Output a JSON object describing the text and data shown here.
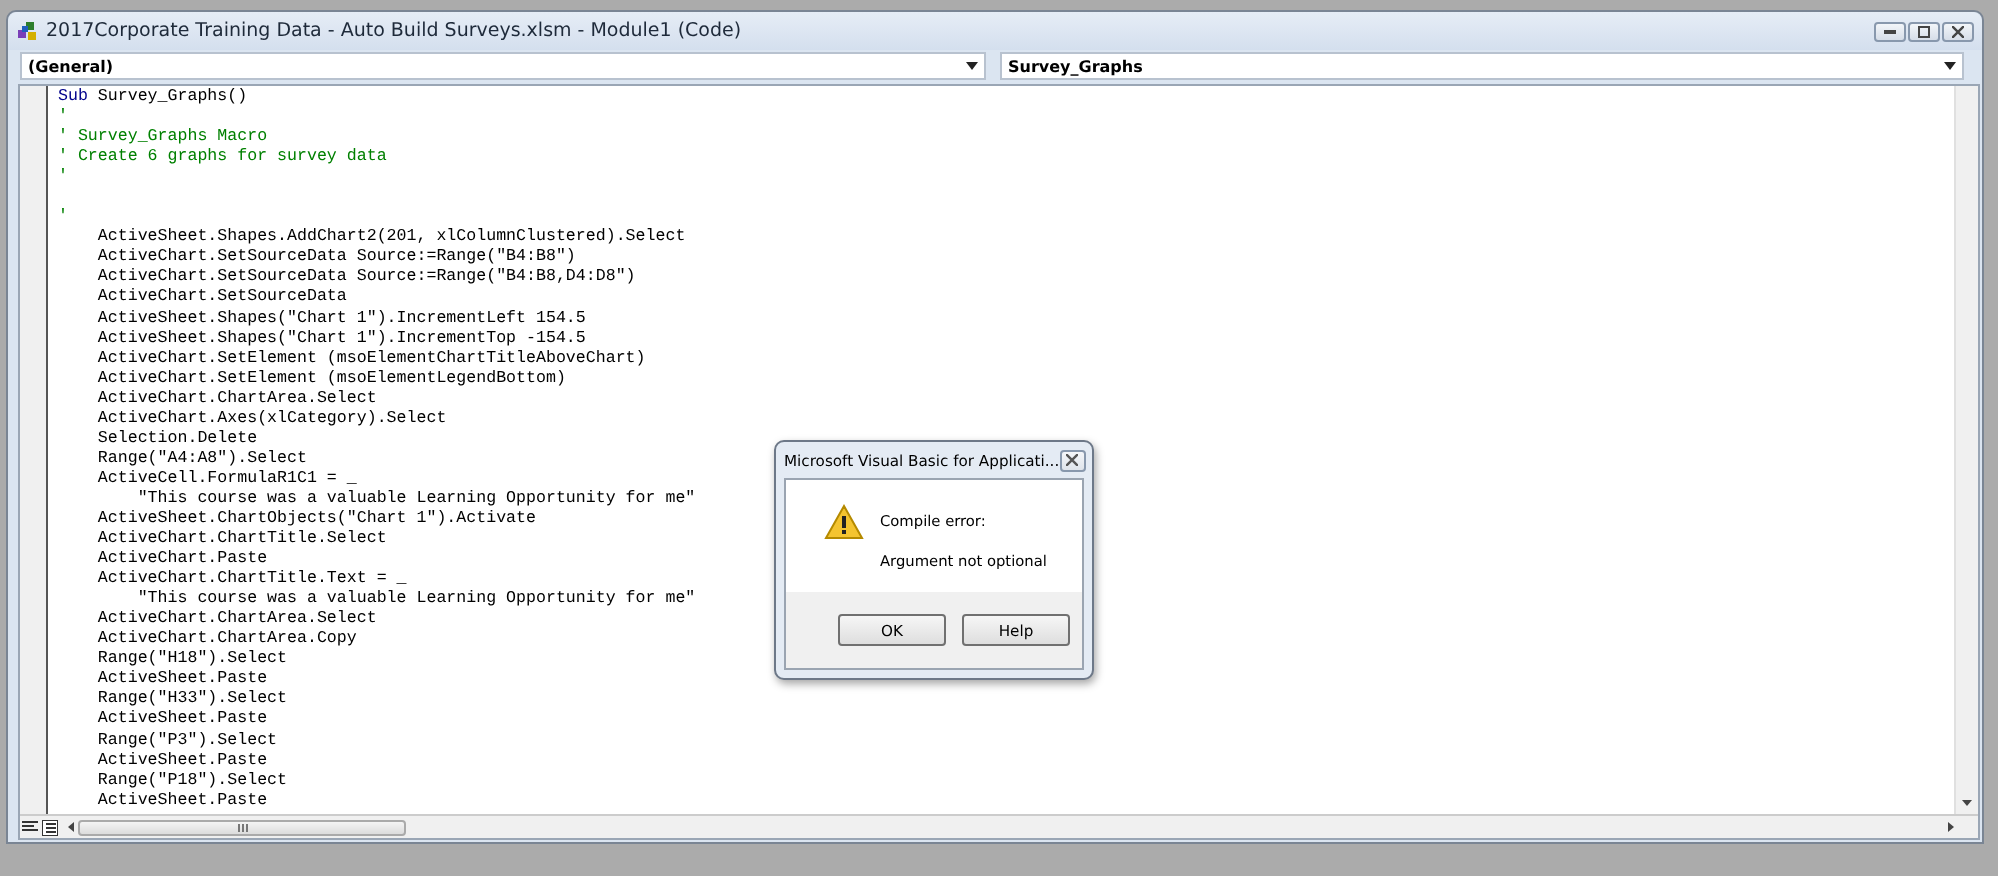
{
  "window": {
    "title": "2017Corporate Training Data - Auto Build Surveys.xlsm - Module1 (Code)"
  },
  "object_dropdown": {
    "value": "(General)"
  },
  "procedure_dropdown": {
    "value": "Survey_Graphs"
  },
  "code_lines": [
    {
      "kind": "code",
      "parts": [
        {
          "kind": "keyword",
          "text": "Sub"
        },
        {
          "kind": "plain",
          "text": " Survey_Graphs()"
        }
      ]
    },
    {
      "kind": "code",
      "parts": [
        {
          "kind": "comment",
          "text": "'"
        }
      ]
    },
    {
      "kind": "code",
      "parts": [
        {
          "kind": "comment",
          "text": "' Survey_Graphs Macro"
        }
      ]
    },
    {
      "kind": "code",
      "parts": [
        {
          "kind": "comment",
          "text": "' Create 6 graphs for survey data"
        }
      ]
    },
    {
      "kind": "code",
      "parts": [
        {
          "kind": "comment",
          "text": "'"
        }
      ]
    },
    {
      "kind": "blank"
    },
    {
      "kind": "code",
      "parts": [
        {
          "kind": "comment",
          "text": "'"
        }
      ]
    },
    {
      "kind": "code",
      "parts": [
        {
          "kind": "plain",
          "text": "    ActiveSheet.Shapes.AddChart2(201, xlColumnClustered).Select"
        }
      ]
    },
    {
      "kind": "code",
      "parts": [
        {
          "kind": "plain",
          "text": "    ActiveChart.SetSourceData Source:=Range(\"B4:B8\")"
        }
      ]
    },
    {
      "kind": "code",
      "parts": [
        {
          "kind": "plain",
          "text": "    ActiveChart.SetSourceData Source:=Range(\"B4:B8,D4:D8\")"
        }
      ]
    },
    {
      "kind": "code",
      "parts": [
        {
          "kind": "plain",
          "text": "    ActiveChart.SetSourceData"
        }
      ]
    },
    {
      "kind": "code",
      "parts": [
        {
          "kind": "plain",
          "text": "    ActiveSheet.Shapes(\"Chart 1\").IncrementLeft 154.5"
        }
      ]
    },
    {
      "kind": "code",
      "parts": [
        {
          "kind": "plain",
          "text": "    ActiveSheet.Shapes(\"Chart 1\").IncrementTop -154.5"
        }
      ]
    },
    {
      "kind": "code",
      "parts": [
        {
          "kind": "plain",
          "text": "    ActiveChart.SetElement (msoElementChartTitleAboveChart)"
        }
      ]
    },
    {
      "kind": "code",
      "parts": [
        {
          "kind": "plain",
          "text": "    ActiveChart.SetElement (msoElementLegendBottom)"
        }
      ]
    },
    {
      "kind": "code",
      "parts": [
        {
          "kind": "plain",
          "text": "    ActiveChart.ChartArea.Select"
        }
      ]
    },
    {
      "kind": "code",
      "parts": [
        {
          "kind": "plain",
          "text": "    ActiveChart.Axes(xlCategory).Select"
        }
      ]
    },
    {
      "kind": "code",
      "parts": [
        {
          "kind": "plain",
          "text": "    Selection.Delete"
        }
      ]
    },
    {
      "kind": "code",
      "parts": [
        {
          "kind": "plain",
          "text": "    Range(\"A4:A8\").Select"
        }
      ]
    },
    {
      "kind": "code",
      "parts": [
        {
          "kind": "plain",
          "text": "    ActiveCell.FormulaR1C1 = _"
        }
      ]
    },
    {
      "kind": "code",
      "parts": [
        {
          "kind": "plain",
          "text": "        \"This course was a valuable Learning Opportunity for me\""
        }
      ]
    },
    {
      "kind": "code",
      "parts": [
        {
          "kind": "plain",
          "text": "    ActiveSheet.ChartObjects(\"Chart 1\").Activate"
        }
      ]
    },
    {
      "kind": "code",
      "parts": [
        {
          "kind": "plain",
          "text": "    ActiveChart.ChartTitle.Select"
        }
      ]
    },
    {
      "kind": "code",
      "parts": [
        {
          "kind": "plain",
          "text": "    ActiveChart.Paste"
        }
      ]
    },
    {
      "kind": "code",
      "parts": [
        {
          "kind": "plain",
          "text": "    ActiveChart.ChartTitle.Text = _"
        }
      ]
    },
    {
      "kind": "code",
      "parts": [
        {
          "kind": "plain",
          "text": "        \"This course was a valuable Learning Opportunity for me\""
        }
      ]
    },
    {
      "kind": "code",
      "parts": [
        {
          "kind": "plain",
          "text": "    ActiveChart.ChartArea.Select"
        }
      ]
    },
    {
      "kind": "code",
      "parts": [
        {
          "kind": "plain",
          "text": "    ActiveChart.ChartArea.Copy"
        }
      ]
    },
    {
      "kind": "code",
      "parts": [
        {
          "kind": "plain",
          "text": "    Range(\"H18\").Select"
        }
      ]
    },
    {
      "kind": "code",
      "parts": [
        {
          "kind": "plain",
          "text": "    ActiveSheet.Paste"
        }
      ]
    },
    {
      "kind": "code",
      "parts": [
        {
          "kind": "plain",
          "text": "    Range(\"H33\").Select"
        }
      ]
    },
    {
      "kind": "code",
      "parts": [
        {
          "kind": "plain",
          "text": "    ActiveSheet.Paste"
        }
      ]
    },
    {
      "kind": "code",
      "parts": [
        {
          "kind": "plain",
          "text": "    Range(\"P3\").Select"
        }
      ]
    },
    {
      "kind": "code",
      "parts": [
        {
          "kind": "plain",
          "text": "    ActiveSheet.Paste"
        }
      ]
    },
    {
      "kind": "code",
      "parts": [
        {
          "kind": "plain",
          "text": "    Range(\"P18\").Select"
        }
      ]
    },
    {
      "kind": "code",
      "parts": [
        {
          "kind": "plain",
          "text": "    ActiveSheet.Paste"
        }
      ]
    }
  ],
  "dialog": {
    "title": "Microsoft Visual Basic for Applicati...",
    "heading": "Compile error:",
    "message": "Argument not optional",
    "buttons": [
      "OK",
      "Help"
    ]
  }
}
